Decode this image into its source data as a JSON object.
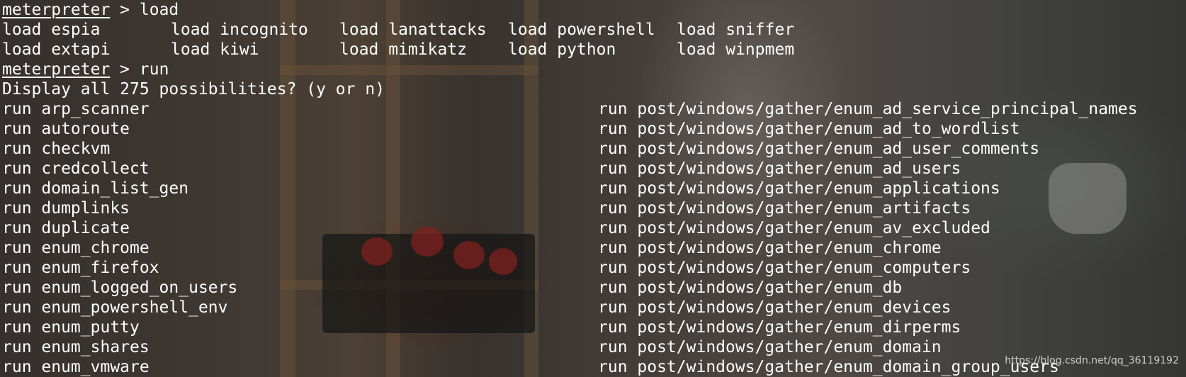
{
  "terminal": {
    "prompt_name": "meterpreter",
    "prompt_sep": " > ",
    "cmd_load": "load",
    "cmd_run": "run",
    "load_grid": [
      [
        "load espia",
        "load incognito",
        "load lanattacks",
        "load powershell",
        "load sniffer"
      ],
      [
        "load extapi",
        "load kiwi",
        "load mimikatz",
        "load python",
        "load winpmem"
      ]
    ],
    "display_prompt": "Display all 275 possibilities? (y or n)",
    "run_left": [
      "run arp_scanner",
      "run autoroute",
      "run checkvm",
      "run credcollect",
      "run domain_list_gen",
      "run dumplinks",
      "run duplicate",
      "run enum_chrome",
      "run enum_firefox",
      "run enum_logged_on_users",
      "run enum_powershell_env",
      "run enum_putty",
      "run enum_shares",
      "run enum_vmware"
    ],
    "run_right": [
      "run post/windows/gather/enum_ad_service_principal_names",
      "run post/windows/gather/enum_ad_to_wordlist",
      "run post/windows/gather/enum_ad_user_comments",
      "run post/windows/gather/enum_ad_users",
      "run post/windows/gather/enum_applications",
      "run post/windows/gather/enum_artifacts",
      "run post/windows/gather/enum_av_excluded",
      "run post/windows/gather/enum_chrome",
      "run post/windows/gather/enum_computers",
      "run post/windows/gather/enum_db",
      "run post/windows/gather/enum_devices",
      "run post/windows/gather/enum_dirperms",
      "run post/windows/gather/enum_domain",
      "run post/windows/gather/enum_domain_group_users"
    ]
  },
  "watermark": "https://blog.csdn.net/qq_36119192",
  "colors": {
    "text": "#ffffff"
  }
}
